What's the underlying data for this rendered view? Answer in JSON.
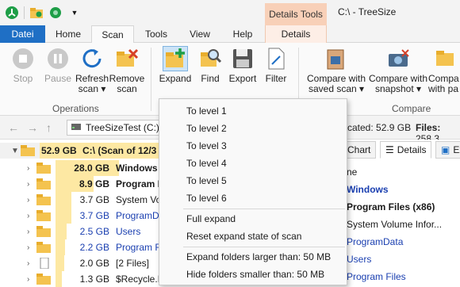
{
  "window": {
    "title": "C:\\ - TreeSize",
    "context_tab_group": "Details Tools"
  },
  "colors": {
    "file_tab": "#1f6fc5",
    "accent": "#f8d0b8",
    "size_bar": "#fde8a3"
  },
  "tabs": [
    {
      "label": "Datei"
    },
    {
      "label": "Home"
    },
    {
      "label": "Scan"
    },
    {
      "label": "Tools"
    },
    {
      "label": "View"
    },
    {
      "label": "Help"
    },
    {
      "label": "Details"
    }
  ],
  "ribbon": {
    "stop": "Stop",
    "pause": "Pause",
    "refresh_1": "Refresh",
    "refresh_2": "scan",
    "remove_1": "Remove",
    "remove_2": "scan",
    "expand": "Expand",
    "find": "Find",
    "export": "Export",
    "filter": "Filter",
    "cmp_saved_1": "Compare with",
    "cmp_saved_2": "saved scan",
    "cmp_snap_1": "Compare with",
    "cmp_snap_2": "snapshot",
    "cmp_third_1": "Compa",
    "cmp_third_2": "with pa",
    "group_operations": "Operations",
    "group_compare": "Compare"
  },
  "address": {
    "drive": "TreeSizeTest (C:)",
    "allocated_label": "cated:",
    "allocated_value": "52.9 GB",
    "files_label": "Files:",
    "files_value": "258,3"
  },
  "tree": {
    "root_size": "52.9 GB",
    "root_name": "C:\\  (Scan of 12/3",
    "rows": [
      {
        "size": "28.0 GB",
        "name": "Windows"
      },
      {
        "size": "8.9 GB",
        "name": "Program F"
      },
      {
        "size": "3.7 GB",
        "name": "System Vo"
      },
      {
        "size": "3.7 GB",
        "name": "ProgramD"
      },
      {
        "size": "2.5 GB",
        "name": "Users"
      },
      {
        "size": "2.2 GB",
        "name": "Program F"
      },
      {
        "size": "2.0 GB",
        "name": "[2 Files]"
      },
      {
        "size": "1.3 GB",
        "name": "$Recycle.B"
      }
    ]
  },
  "right_panel": {
    "tab_chart": "Chart",
    "tab_details": "Details",
    "tab_more": "Ex",
    "items": [
      "ne",
      "Windows",
      "Program Files (x86)",
      "System Volume Infor...",
      "ProgramData",
      "Users",
      "Program Files"
    ]
  },
  "expand_menu": {
    "level_1": "To level 1",
    "level_2": "To level 2",
    "level_3": "To level 3",
    "level_4": "To level 4",
    "level_5": "To level 5",
    "level_6": "To level 6",
    "full": "Full expand",
    "reset": "Reset expand state of scan",
    "larger": "Expand folders larger than:  50 MB",
    "smaller": "Hide folders smaller than:  50 MB"
  },
  "size_bars": [
    1.0,
    0.53,
    0.32,
    0.13,
    0.13,
    0.09,
    0.08,
    0.07,
    0.05
  ]
}
